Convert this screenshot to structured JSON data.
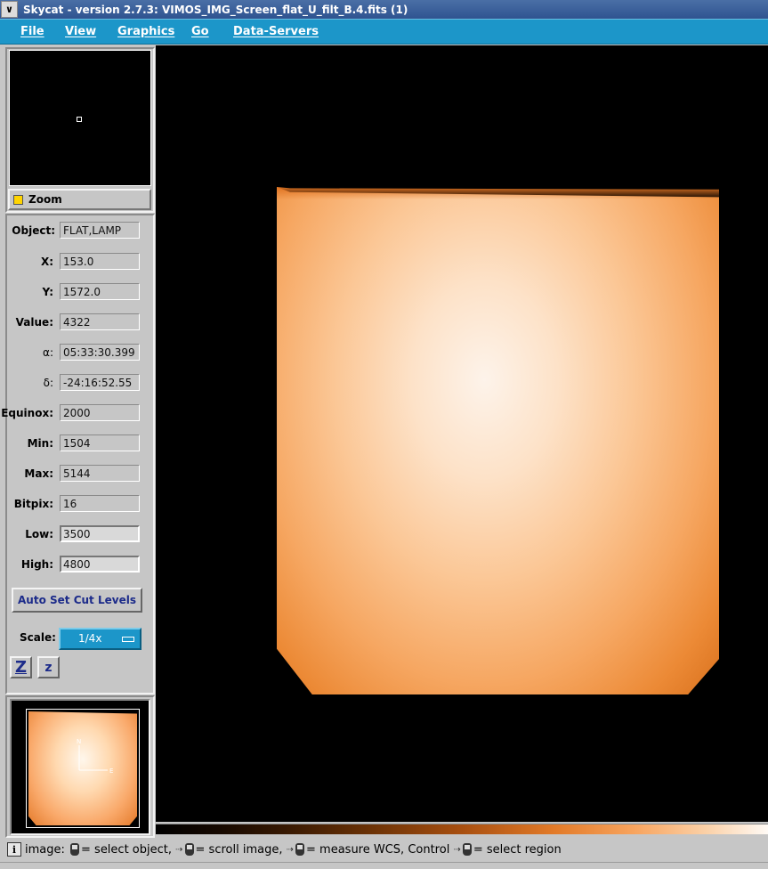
{
  "window": {
    "title": "Skycat - version 2.7.3: VIMOS_IMG_Screen_flat_U_filt_B.4.fits (1)",
    "menu_icon": "chevron-down-icon"
  },
  "menubar": {
    "items": [
      "File",
      "View",
      "Graphics",
      "Go",
      "Data-Servers"
    ]
  },
  "zoom_panel": {
    "toggle_label": "Zoom",
    "indicator_color": "#ffd400"
  },
  "info": {
    "object_label": "Object:",
    "object_value": "FLAT,LAMP",
    "x_label": "X:",
    "x_value": "153.0",
    "y_label": "Y:",
    "y_value": "1572.0",
    "value_label": "Value:",
    "value_value": "4322",
    "alpha_label": "α:",
    "alpha_value": "05:33:30.399",
    "delta_label": "δ:",
    "delta_value": "-24:16:52.55",
    "equinox_label": "Equinox:",
    "equinox_value": "2000",
    "min_label": "Min:",
    "min_value": "1504",
    "max_label": "Max:",
    "max_value": "5144",
    "bitpix_label": "Bitpix:",
    "bitpix_value": "16",
    "low_label": "Low:",
    "low_value": "3500",
    "high_label": "High:",
    "high_value": "4800"
  },
  "controls": {
    "auto_cut_label": "Auto Set Cut Levels",
    "scale_label": "Scale:",
    "scale_value": "1/4x",
    "zoom_in_label": "Z",
    "zoom_out_label": "z"
  },
  "panner": {
    "compass_n": "N",
    "compass_e": "E"
  },
  "colors": {
    "menubar": "#1c96c9",
    "image_background": "#000000",
    "flat_core": "#fdf3ea",
    "flat_edge": "#d9711d"
  },
  "status": {
    "prefix": "image:",
    "part1": "= select object,",
    "part2": "= scroll image,",
    "part3": "= measure WCS, Control",
    "part4": "= select region"
  }
}
